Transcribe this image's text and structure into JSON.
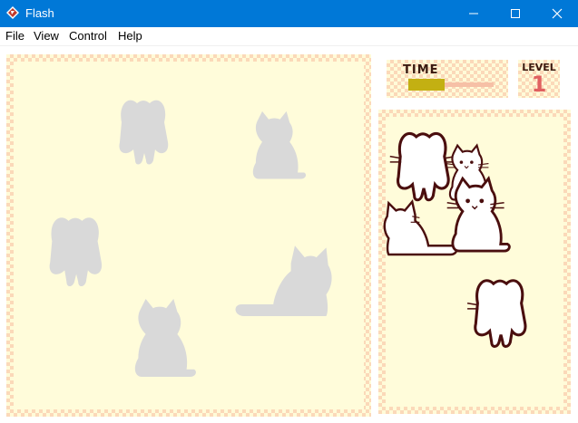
{
  "window": {
    "title": "Flash",
    "icon": "flash-player-icon",
    "controls": [
      "minimize-icon",
      "maximize-icon",
      "close-icon"
    ]
  },
  "menu": [
    "File",
    "View",
    "Control",
    "Help"
  ],
  "hud": {
    "time_label": "TIME",
    "time_remaining_fraction": 0.43,
    "level_label": "LEVEL",
    "level_value": "1"
  },
  "game": {
    "silhouettes": [
      "cat-back",
      "cat-front",
      "cat-back",
      "cat-side-lying",
      "cat-front"
    ],
    "tray_cats": [
      "cat-back",
      "cat-front",
      "cat-front-sitting",
      "cat-lying",
      "cat-back"
    ]
  },
  "colors": {
    "titlebar": "#0078d7",
    "board_bg": "#fffcda",
    "checker": "#fbd9b9",
    "silhouette": "#d9d9d9",
    "cat_outline": "#4a0e0e",
    "time_fill": "#c3b012",
    "level_number": "#e06060"
  }
}
